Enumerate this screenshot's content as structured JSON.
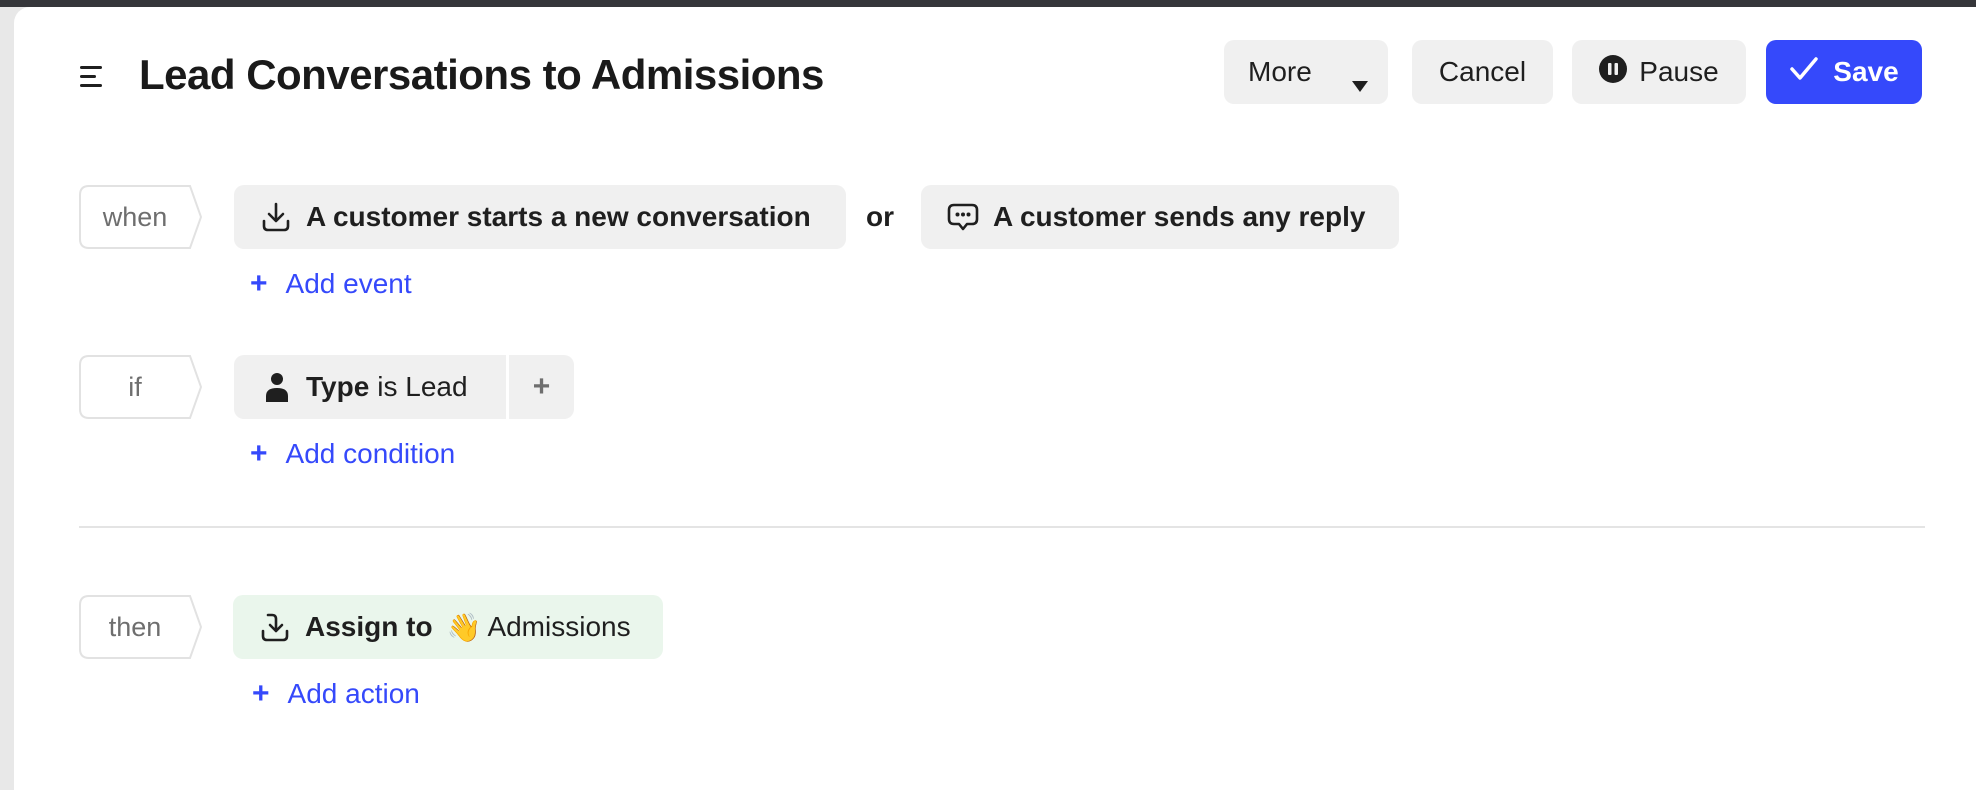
{
  "header": {
    "title": "Lead Conversations to Admissions",
    "menu_icon": "hamburger-menu-icon",
    "buttons": {
      "more": "More",
      "cancel": "Cancel",
      "pause": "Pause",
      "save": "Save"
    }
  },
  "when": {
    "label": "when",
    "events": [
      {
        "icon": "inbox-download-icon",
        "label": "A customer starts a new conversation"
      },
      {
        "icon": "chat-bubble-icon",
        "label": "A customer sends any reply"
      }
    ],
    "connector": "or",
    "add_label": "Add event"
  },
  "if": {
    "label": "if",
    "conditions": [
      {
        "icon": "person-icon",
        "attribute": "Type",
        "operator_value": "is Lead"
      }
    ],
    "add_inline": "+",
    "add_label": "Add condition"
  },
  "then": {
    "label": "then",
    "actions": [
      {
        "icon": "assign-icon",
        "verb": "Assign to",
        "emoji": "👋",
        "target": "Admissions"
      }
    ],
    "add_label": "Add action"
  },
  "colors": {
    "accent": "#3549fb",
    "pill_bg": "#f0f0f0",
    "action_bg": "#eaf6ec"
  }
}
